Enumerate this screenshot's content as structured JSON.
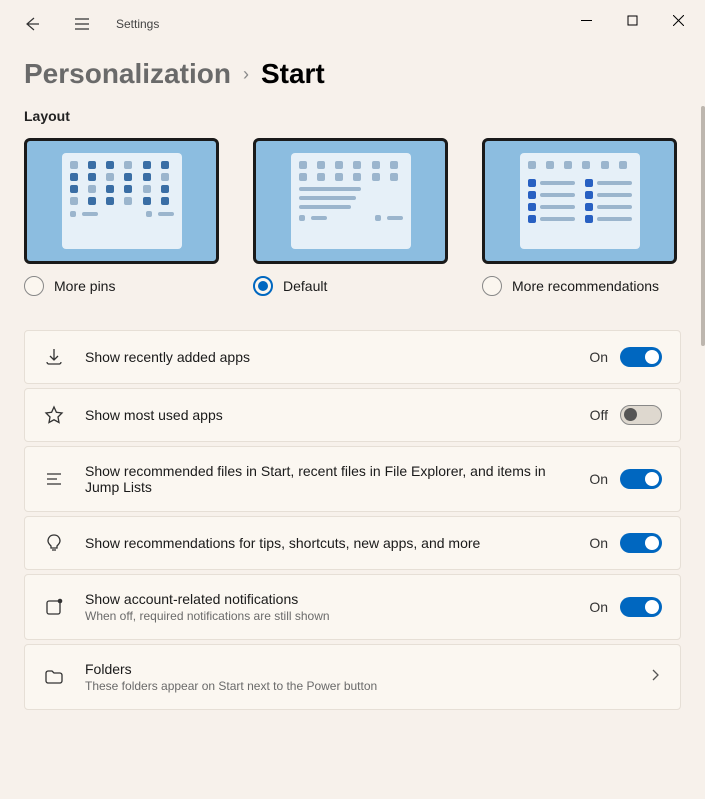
{
  "app": {
    "title": "Settings"
  },
  "breadcrumb": {
    "parent": "Personalization",
    "current": "Start"
  },
  "section": {
    "layout_title": "Layout"
  },
  "layout_options": [
    {
      "label": "More pins",
      "kind": "pins",
      "checked": false
    },
    {
      "label": "Default",
      "kind": "default",
      "checked": true
    },
    {
      "label": "More recommendations",
      "kind": "reco",
      "checked": false
    }
  ],
  "settings": [
    {
      "icon": "download",
      "title": "Show recently added apps",
      "subtitle": "",
      "state": "On",
      "on": true,
      "type": "toggle"
    },
    {
      "icon": "star",
      "title": "Show most used apps",
      "subtitle": "",
      "state": "Off",
      "on": false,
      "type": "toggle"
    },
    {
      "icon": "list",
      "title": "Show recommended files in Start, recent files in File Explorer, and items in Jump Lists",
      "subtitle": "",
      "state": "On",
      "on": true,
      "type": "toggle"
    },
    {
      "icon": "bulb",
      "title": "Show recommendations for tips, shortcuts, new apps, and more",
      "subtitle": "",
      "state": "On",
      "on": true,
      "type": "toggle"
    },
    {
      "icon": "badge",
      "title": "Show account-related notifications",
      "subtitle": "When off, required notifications are still shown",
      "state": "On",
      "on": true,
      "type": "toggle"
    },
    {
      "icon": "folder",
      "title": "Folders",
      "subtitle": "These folders appear on Start next to the Power button",
      "state": "",
      "on": null,
      "type": "nav"
    }
  ]
}
